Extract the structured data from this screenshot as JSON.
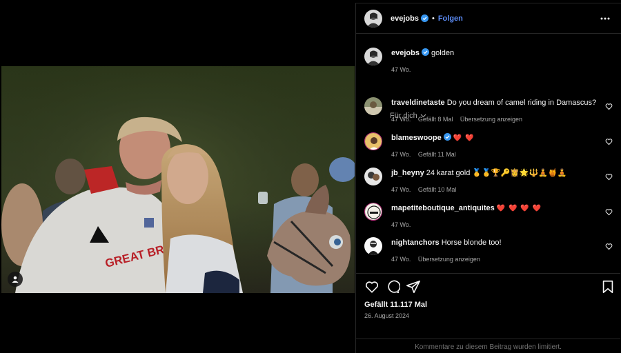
{
  "post": {
    "author": "evejobs",
    "follow_label": "Folgen",
    "separator": "•",
    "caption": "golden",
    "caption_age": "47 Wo."
  },
  "comments_filter": "Für dich",
  "comments": [
    {
      "user": "traveldinetaste",
      "text": "Do you dream of camel riding in Damascus?",
      "age": "47 Wo.",
      "likes": "Gefällt 8 Mal",
      "translate": "Übersetzung anzeigen"
    },
    {
      "user": "blameswoope",
      "verified": true,
      "text": "❤️ ❤️",
      "age": "47 Wo.",
      "likes": "Gefällt 11 Mal"
    },
    {
      "user": "jb_heyny",
      "text": "24 karat gold 🥇🥇🏆🔑👸🌟🔱🧘🍯🧘",
      "age": "47 Wo.",
      "likes": "Gefällt 10 Mal"
    },
    {
      "user": "mapetiteboutique_antiquites",
      "text": "❤️ ❤️ ❤️ ❤️",
      "age": "47 Wo."
    },
    {
      "user": "nightanchors",
      "text": "Horse blonde too!",
      "age": "47 Wo.",
      "translate": "Übersetzung anzeigen"
    }
  ],
  "stats": {
    "likes": "Gefällt 11.117 Mal",
    "date": "26. August 2024"
  },
  "footer": "Kommentare zu diesem Beitrag wurden limitiert.",
  "icons": {
    "like": "heart-icon",
    "comment": "comment-icon",
    "share": "share-icon",
    "save": "bookmark-icon",
    "more": "more-icon",
    "tag": "user-tag-icon"
  },
  "colors": {
    "background": "#000000",
    "accent": "#5c8cf6",
    "verified": "#3897f0",
    "heart": "#ff3040",
    "muted": "#a8a8a8"
  }
}
